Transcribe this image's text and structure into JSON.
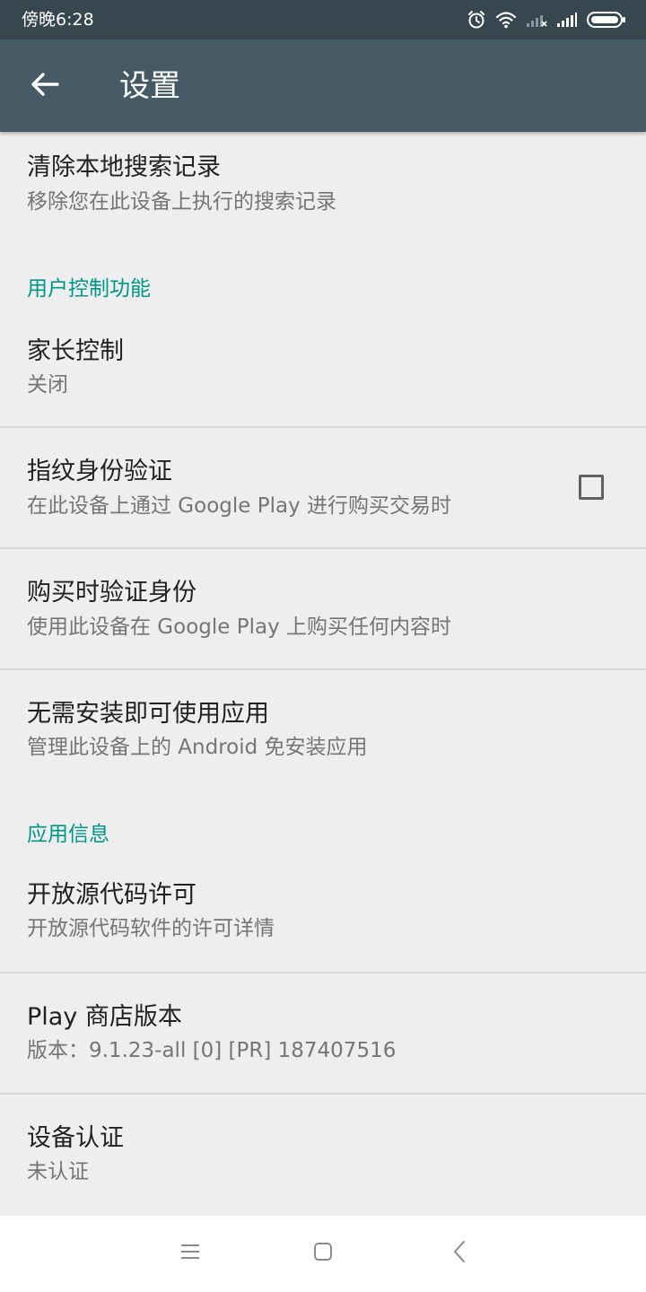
{
  "status_bar": {
    "time": "傍晚6:28"
  },
  "app_bar": {
    "title": "设置"
  },
  "clear_search": {
    "title": "清除本地搜索记录",
    "subtitle": "移除您在此设备上执行的搜索记录"
  },
  "section_user_controls": "用户控制功能",
  "parental_controls": {
    "title": "家长控制",
    "subtitle": "关闭"
  },
  "fingerprint": {
    "title": "指纹身份验证",
    "subtitle": "在此设备上通过 Google Play 进行购买交易时",
    "checked": false
  },
  "purchase_auth": {
    "title": "购买时验证身份",
    "subtitle": "使用此设备在 Google Play 上购买任何内容时"
  },
  "instant_apps": {
    "title": "无需安装即可使用应用",
    "subtitle": "管理此设备上的 Android 免安装应用"
  },
  "section_app_info": "应用信息",
  "open_source": {
    "title": "开放源代码许可",
    "subtitle": "开放源代码软件的许可详情"
  },
  "play_version": {
    "title": "Play 商店版本",
    "subtitle": "版本：9.1.23-all [0] [PR] 187407516"
  },
  "device_cert": {
    "title": "设备认证",
    "subtitle": "未认证"
  },
  "icons": {
    "status": [
      "alarm-icon",
      "wifi-icon",
      "signal-no-sim-icon",
      "signal-icon",
      "battery-icon"
    ],
    "back": "arrow-left-icon",
    "nav": [
      "menu-icon",
      "home-icon",
      "back-icon"
    ]
  },
  "colors": {
    "status_bar": "#37474f",
    "app_bar": "#455a64",
    "accent": "#009688",
    "background": "#eeeeee"
  }
}
